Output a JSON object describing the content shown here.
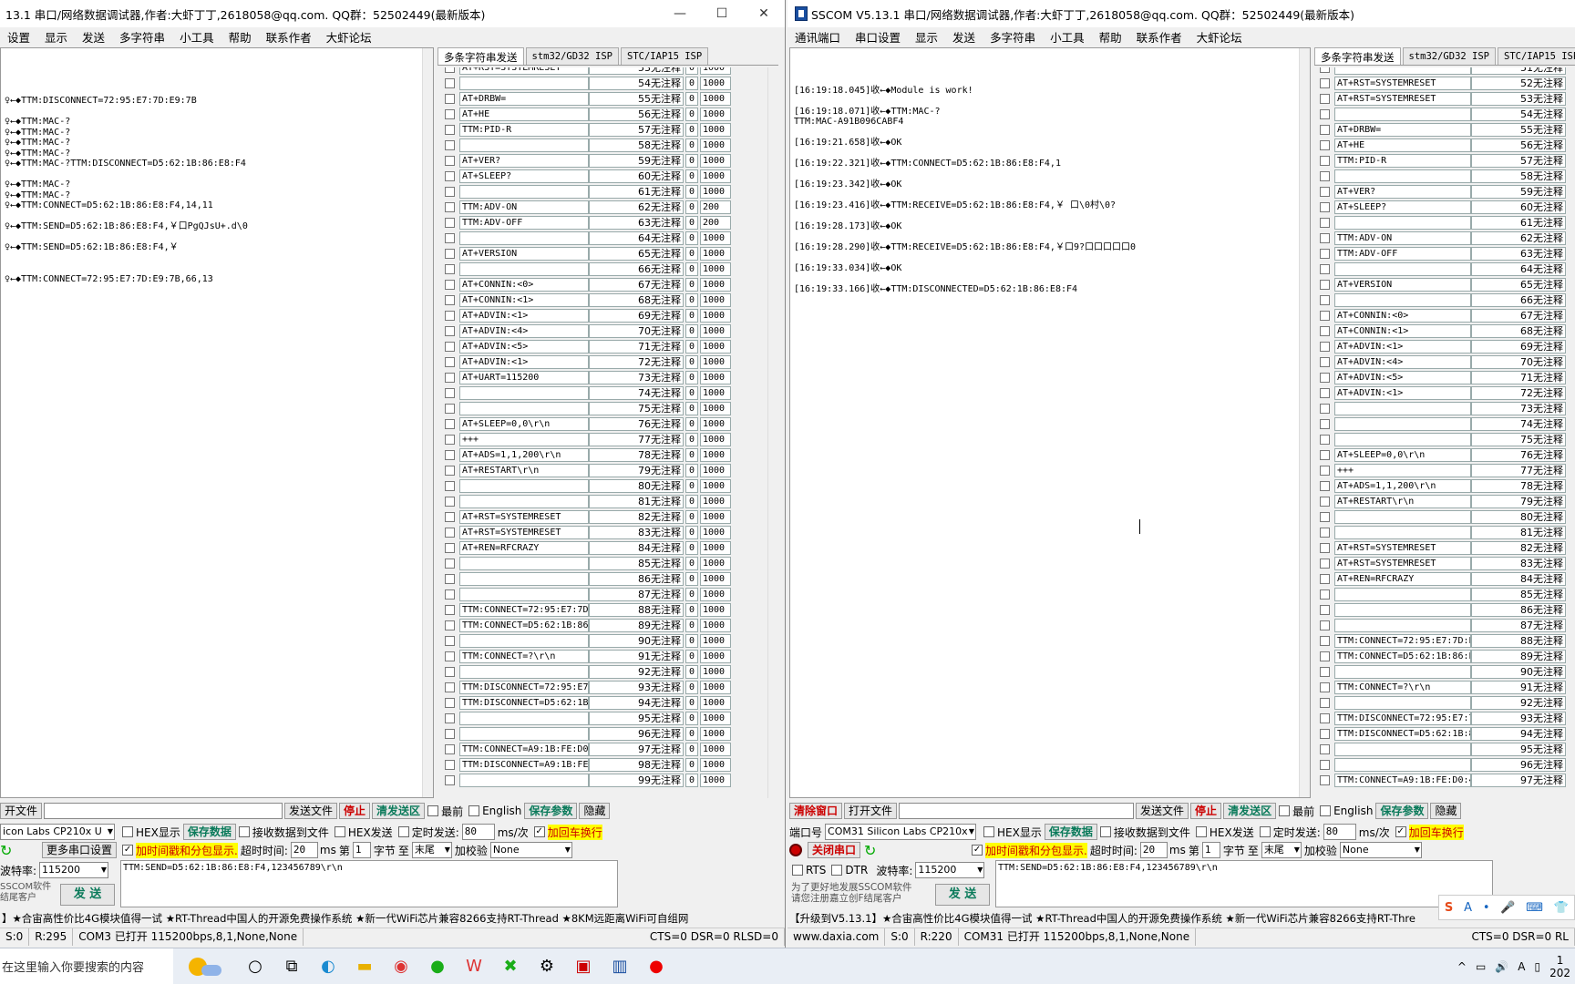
{
  "left": {
    "title": "13.1 串口/网络数据调试器,作者:大虾丁丁,2618058@qq.com. QQ群：52502449(最新版本)",
    "menu": [
      "设置",
      "显示",
      "发送",
      "多字符串",
      "小工具",
      "帮助",
      "联系作者",
      "大虾论坛"
    ],
    "recv_lines": [
      "",
      "♀←◆TTM:DISCONNECT=72:95:E7:7D:E9:7B",
      "",
      "♀←◆TTM:MAC-?",
      "♀←◆TTM:MAC-?",
      "♀←◆TTM:MAC-?",
      "♀←◆TTM:MAC-?",
      "♀←◆TTM:MAC-?TTM:DISCONNECT=D5:62:1B:86:E8:F4",
      "",
      "♀←◆TTM:MAC-?",
      "♀←◆TTM:MAC-?",
      "♀←◆TTM:CONNECT=D5:62:1B:86:E8:F4,14,11",
      "",
      "♀←◆TTM:SEND=D5:62:1B:86:E8:F4,￥口PgQJsU+.d\\0",
      "",
      "♀←◆TTM:SEND=D5:62:1B:86:E8:F4,￥",
      "",
      "",
      "♀←◆TTM:CONNECT=72:95:E7:7D:E9:7B,66,13"
    ],
    "tabs": [
      "多条字符串发送",
      "stm32/GD32 ISP",
      "STC/IAP15 ISP"
    ],
    "rows": [
      {
        "cmd": "AT+RST=SYSTEMRESET",
        "btn": "53无注释",
        "ord": "0",
        "dly": "1000"
      },
      {
        "cmd": "",
        "btn": "54无注释",
        "ord": "0",
        "dly": "1000"
      },
      {
        "cmd": "AT+DRBW=",
        "btn": "55无注释",
        "ord": "0",
        "dly": "1000"
      },
      {
        "cmd": "AT+HE",
        "btn": "56无注释",
        "ord": "0",
        "dly": "1000"
      },
      {
        "cmd": "TTM:PID-R",
        "btn": "57无注释",
        "ord": "0",
        "dly": "1000"
      },
      {
        "cmd": "",
        "btn": "58无注释",
        "ord": "0",
        "dly": "1000"
      },
      {
        "cmd": "AT+VER?",
        "btn": "59无注释",
        "ord": "0",
        "dly": "1000"
      },
      {
        "cmd": "AT+SLEEP?",
        "btn": "60无注释",
        "ord": "0",
        "dly": "1000"
      },
      {
        "cmd": "",
        "btn": "61无注释",
        "ord": "0",
        "dly": "1000"
      },
      {
        "cmd": "TTM:ADV-ON",
        "btn": "62无注释",
        "ord": "0",
        "dly": "200"
      },
      {
        "cmd": "TTM:ADV-OFF",
        "btn": "63无注释",
        "ord": "0",
        "dly": "200"
      },
      {
        "cmd": "",
        "btn": "64无注释",
        "ord": "0",
        "dly": "1000"
      },
      {
        "cmd": "AT+VERSION",
        "btn": "65无注释",
        "ord": "0",
        "dly": "1000"
      },
      {
        "cmd": "",
        "btn": "66无注释",
        "ord": "0",
        "dly": "1000"
      },
      {
        "cmd": "AT+CONNIN:<0>",
        "btn": "67无注释",
        "ord": "0",
        "dly": "1000"
      },
      {
        "cmd": "AT+CONNIN:<1>",
        "btn": "68无注释",
        "ord": "0",
        "dly": "1000"
      },
      {
        "cmd": "AT+ADVIN:<1>",
        "btn": "69无注释",
        "ord": "0",
        "dly": "1000"
      },
      {
        "cmd": "AT+ADVIN:<4>",
        "btn": "70无注释",
        "ord": "0",
        "dly": "1000"
      },
      {
        "cmd": "AT+ADVIN:<5>",
        "btn": "71无注释",
        "ord": "0",
        "dly": "1000"
      },
      {
        "cmd": "AT+ADVIN:<1>",
        "btn": "72无注释",
        "ord": "0",
        "dly": "1000"
      },
      {
        "cmd": "AT+UART=115200",
        "btn": "73无注释",
        "ord": "0",
        "dly": "1000"
      },
      {
        "cmd": "",
        "btn": "74无注释",
        "ord": "0",
        "dly": "1000"
      },
      {
        "cmd": "",
        "btn": "75无注释",
        "ord": "0",
        "dly": "1000"
      },
      {
        "cmd": "AT+SLEEP=0,0\\r\\n",
        "btn": "76无注释",
        "ord": "0",
        "dly": "1000"
      },
      {
        "cmd": "+++",
        "btn": "77无注释",
        "ord": "0",
        "dly": "1000"
      },
      {
        "cmd": "AT+ADS=1,1,200\\r\\n",
        "btn": "78无注释",
        "ord": "0",
        "dly": "1000"
      },
      {
        "cmd": "AT+RESTART\\r\\n",
        "btn": "79无注释",
        "ord": "0",
        "dly": "1000"
      },
      {
        "cmd": "",
        "btn": "80无注释",
        "ord": "0",
        "dly": "1000"
      },
      {
        "cmd": "",
        "btn": "81无注释",
        "ord": "0",
        "dly": "1000"
      },
      {
        "cmd": "AT+RST=SYSTEMRESET",
        "btn": "82无注释",
        "ord": "0",
        "dly": "1000"
      },
      {
        "cmd": "AT+RST=SYSTEMRESET",
        "btn": "83无注释",
        "ord": "0",
        "dly": "1000"
      },
      {
        "cmd": "AT+REN=RFCRAZY",
        "btn": "84无注释",
        "ord": "0",
        "dly": "1000"
      },
      {
        "cmd": "",
        "btn": "85无注释",
        "ord": "0",
        "dly": "1000"
      },
      {
        "cmd": "",
        "btn": "86无注释",
        "ord": "0",
        "dly": "1000"
      },
      {
        "cmd": "",
        "btn": "87无注释",
        "ord": "0",
        "dly": "1000"
      },
      {
        "cmd": "TTM:CONNECT=72:95:E7:7D:E9",
        "btn": "88无注释",
        "ord": "0",
        "dly": "1000"
      },
      {
        "cmd": "TTM:CONNECT=D5:62:1B:86:E8",
        "btn": "89无注释",
        "ord": "0",
        "dly": "1000"
      },
      {
        "cmd": "",
        "btn": "90无注释",
        "ord": "0",
        "dly": "1000"
      },
      {
        "cmd": "TTM:CONNECT=?\\r\\n",
        "btn": "91无注释",
        "ord": "0",
        "dly": "1000"
      },
      {
        "cmd": "",
        "btn": "92无注释",
        "ord": "0",
        "dly": "1000"
      },
      {
        "cmd": "TTM:DISCONNECT=72:95:E7:7I",
        "btn": "93无注释",
        "ord": "0",
        "dly": "1000"
      },
      {
        "cmd": "TTM:DISCONNECT=D5:62:1B:86",
        "btn": "94无注释",
        "ord": "0",
        "dly": "1000"
      },
      {
        "cmd": "",
        "btn": "95无注释",
        "ord": "0",
        "dly": "1000"
      },
      {
        "cmd": "",
        "btn": "96无注释",
        "ord": "0",
        "dly": "1000"
      },
      {
        "cmd": "TTM:CONNECT=A9:1B:FE:D0:4E",
        "btn": "97无注释",
        "ord": "0",
        "dly": "1000"
      },
      {
        "cmd": "TTM:DISCONNECT=A9:1B:FE:DC",
        "btn": "98无注释",
        "ord": "0",
        "dly": "1000"
      },
      {
        "cmd": "",
        "btn": "99无注释",
        "ord": "0",
        "dly": "1000"
      }
    ],
    "bottom": {
      "open_file": "开文件",
      "send_file": "发送文件",
      "stop": "停止",
      "clear_send": "清发送区",
      "top_most": "最前",
      "english": "English",
      "save_params": "保存参数",
      "hide": "隐藏",
      "port": "icon Labs CP210x U",
      "hex_show": "HEX显示",
      "save_data": "保存数据",
      "recv_to_file": "接收数据到文件",
      "hex_send": "HEX发送",
      "timed_send": "定时发送:",
      "interval": "80",
      "unit": "ms/次",
      "crlf": "加回车换行",
      "timestamp": "加时间戳和分包显示.",
      "timeout_label": "超时时间:",
      "timeout": "20",
      "ms": "ms",
      "nth": "第",
      "nth_val": "1",
      "byte": "字节",
      "to": "至",
      "end": "末尾",
      "checksum": "加校验",
      "checksum_val": "None",
      "more_ports": "更多串口设置",
      "baud_label": "波特率:",
      "baud": "115200",
      "send_text": "TTM:SEND=D5:62:1B:86:E8:F4,123456789\\r\\n",
      "sscom_note1": "SSCOM软件",
      "sscom_note2": "结尾客户",
      "send_btn": "发 送"
    },
    "ad": "】★合宙高性价比4G模块值得一试 ★RT-Thread中国人的开源免费操作系统 ★新一代WiFi芯片兼容8266支持RT-Thread ★8KM远距离WiFi可自组网",
    "status": [
      "S:0",
      "R:295",
      "COM3 已打开  115200bps,8,1,None,None",
      "CTS=0 DSR=0 RLSD=0"
    ]
  },
  "right": {
    "title": "SSCOM V5.13.1 串口/网络数据调试器,作者:大虾丁丁,2618058@qq.com. QQ群：52502449(最新版本)",
    "win_ctrls": [
      "—",
      "☐",
      "✕"
    ],
    "menu": [
      "通讯端口",
      "串口设置",
      "显示",
      "发送",
      "多字符串",
      "小工具",
      "帮助",
      "联系作者",
      "大虾论坛"
    ],
    "recv_lines": [
      "[16:19:18.045]收←◆Module is work!",
      "",
      "[16:19:18.071]收←◆TTM:MAC-?",
      "TTM:MAC-A91B096CABF4",
      "",
      "[16:19:21.658]收←◆OK",
      "",
      "[16:19:22.321]收←◆TTM:CONNECT=D5:62:1B:86:E8:F4,1",
      "",
      "[16:19:23.342]收←◆OK",
      "",
      "[16:19:23.416]收←◆TTM:RECEIVE=D5:62:1B:86:E8:F4,￥ 口\\0村\\0?",
      "",
      "[16:19:28.173]收←◆OK",
      "",
      "[16:19:28.290]收←◆TTM:RECEIVE=D5:62:1B:86:E8:F4,￥口9?口口口口口0",
      "",
      "[16:19:33.034]收←◆OK",
      "",
      "[16:19:33.166]收←◆TTM:DISCONNECTED=D5:62:1B:86:E8:F4"
    ],
    "tabs": [
      "多条字符串发送",
      "stm32/GD32 ISP",
      "STC/IAP15 ISP"
    ],
    "rows": [
      {
        "cmd": "",
        "btn": "51无注释"
      },
      {
        "cmd": "AT+RST=SYSTEMRESET",
        "btn": "52无注释"
      },
      {
        "cmd": "AT+RST=SYSTEMRESET",
        "btn": "53无注释"
      },
      {
        "cmd": "",
        "btn": "54无注释"
      },
      {
        "cmd": "AT+DRBW=",
        "btn": "55无注释"
      },
      {
        "cmd": "AT+HE",
        "btn": "56无注释"
      },
      {
        "cmd": "TTM:PID-R",
        "btn": "57无注释"
      },
      {
        "cmd": "",
        "btn": "58无注释"
      },
      {
        "cmd": "AT+VER?",
        "btn": "59无注释"
      },
      {
        "cmd": "AT+SLEEP?",
        "btn": "60无注释"
      },
      {
        "cmd": "",
        "btn": "61无注释"
      },
      {
        "cmd": "TTM:ADV-ON",
        "btn": "62无注释"
      },
      {
        "cmd": "TTM:ADV-OFF",
        "btn": "63无注释"
      },
      {
        "cmd": "",
        "btn": "64无注释"
      },
      {
        "cmd": "AT+VERSION",
        "btn": "65无注释"
      },
      {
        "cmd": "",
        "btn": "66无注释"
      },
      {
        "cmd": "AT+CONNIN:<0>",
        "btn": "67无注释"
      },
      {
        "cmd": "AT+CONNIN:<1>",
        "btn": "68无注释"
      },
      {
        "cmd": "AT+ADVIN:<1>",
        "btn": "69无注释"
      },
      {
        "cmd": "AT+ADVIN:<4>",
        "btn": "70无注释"
      },
      {
        "cmd": "AT+ADVIN:<5>",
        "btn": "71无注释"
      },
      {
        "cmd": "AT+ADVIN:<1>",
        "btn": "72无注释"
      },
      {
        "cmd": "",
        "btn": "73无注释"
      },
      {
        "cmd": "",
        "btn": "74无注释"
      },
      {
        "cmd": "",
        "btn": "75无注释"
      },
      {
        "cmd": "AT+SLEEP=0,0\\r\\n",
        "btn": "76无注释"
      },
      {
        "cmd": "+++",
        "btn": "77无注释"
      },
      {
        "cmd": "AT+ADS=1,1,200\\r\\n",
        "btn": "78无注释"
      },
      {
        "cmd": "AT+RESTART\\r\\n",
        "btn": "79无注释"
      },
      {
        "cmd": "",
        "btn": "80无注释"
      },
      {
        "cmd": "",
        "btn": "81无注释"
      },
      {
        "cmd": "AT+RST=SYSTEMRESET",
        "btn": "82无注释"
      },
      {
        "cmd": "AT+RST=SYSTEMRESET",
        "btn": "83无注释"
      },
      {
        "cmd": "AT+REN=RFCRAZY",
        "btn": "84无注释"
      },
      {
        "cmd": "",
        "btn": "85无注释"
      },
      {
        "cmd": "",
        "btn": "86无注释"
      },
      {
        "cmd": "",
        "btn": "87无注释"
      },
      {
        "cmd": "TTM:CONNECT=72:95:E7:7D:E9",
        "btn": "88无注释"
      },
      {
        "cmd": "TTM:CONNECT=D5:62:1B:86:E8",
        "btn": "89无注释"
      },
      {
        "cmd": "",
        "btn": "90无注释"
      },
      {
        "cmd": "TTM:CONNECT=?\\r\\n",
        "btn": "91无注释"
      },
      {
        "cmd": "",
        "btn": "92无注释"
      },
      {
        "cmd": "TTM:DISCONNECT=72:95:E7:7I",
        "btn": "93无注释"
      },
      {
        "cmd": "TTM:DISCONNECT=D5:62:1B:86",
        "btn": "94无注释"
      },
      {
        "cmd": "",
        "btn": "95无注释"
      },
      {
        "cmd": "",
        "btn": "96无注释"
      },
      {
        "cmd": "TTM:CONNECT=A9:1B:FE:D0:4E",
        "btn": "97无注释"
      }
    ],
    "bottom": {
      "clear_window": "清除窗口",
      "open_file": "打开文件",
      "send_file": "发送文件",
      "stop": "停止",
      "clear_send": "清发送区",
      "top_most": "最前",
      "english": "English",
      "save_params": "保存参数",
      "hide": "隐藏",
      "port_label": "端口号",
      "port": "COM31 Silicon Labs CP210x",
      "hex_show": "HEX显示",
      "save_data": "保存数据",
      "recv_to_file": "接收数据到文件",
      "hex_send": "HEX发送",
      "timed_send": "定时发送:",
      "interval": "80",
      "unit": "ms/次",
      "crlf": "加回车换行",
      "close_port": "关闭串口",
      "timestamp": "加时间戳和分包显示.",
      "timeout_label": "超时时间:",
      "timeout": "20",
      "ms": "ms",
      "nth": "第",
      "nth_val": "1",
      "byte": "字节",
      "to": "至",
      "end": "末尾",
      "checksum": "加校验",
      "checksum_val": "None",
      "rts": "RTS",
      "dtr": "DTR",
      "baud_label": "波特率:",
      "baud": "115200",
      "send_text": "TTM:SEND=D5:62:1B:86:E8:F4,123456789\\r\\n",
      "note1": "为了更好地发展SSCOM软件",
      "note2": "请您注册嘉立创F结尾客户",
      "send_btn": "发 送"
    },
    "ad": "【升级到V5.13.1】★合宙高性价比4G模块值得一试 ★RT-Thread中国人的开源免费操作系统 ★新一代WiFi芯片兼容8266支持RT-Thre",
    "status": [
      "www.daxia.com",
      "S:0",
      "R:220",
      "COM31 已打开  115200bps,8,1,None,None",
      "CTS=0 DSR=0 RL"
    ]
  },
  "taskbar": {
    "search_placeholder": "在这里输入你要搜索的内容",
    "tray_letter": "A",
    "tray_icons": [
      "S",
      "A",
      "•",
      "🎤",
      "⌨",
      "👕"
    ],
    "clock_time": "1",
    "clock_date": "202"
  }
}
